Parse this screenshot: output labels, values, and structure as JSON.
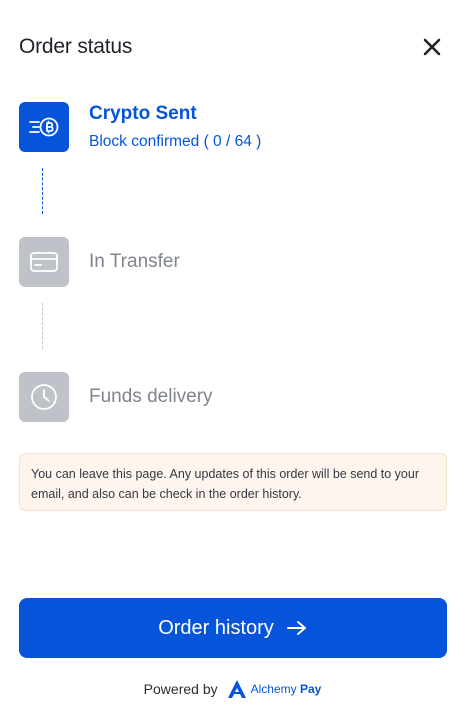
{
  "header": {
    "title": "Order status",
    "close_icon": "close-icon"
  },
  "steps": [
    {
      "title": "Crypto Sent",
      "subtitle": "Block confirmed ( 0 / 64 )",
      "icon": "crypto-send-icon",
      "state": "active"
    },
    {
      "title": "In Transfer",
      "icon": "card-icon",
      "state": "inactive"
    },
    {
      "title": "Funds delivery",
      "icon": "clock-icon",
      "state": "inactive"
    }
  ],
  "notice": {
    "text": "You can leave this page. Any updates of this order will be send to your email, and also can be check in the order history."
  },
  "primary_button": {
    "label": "Order history",
    "icon": "arrow-right-icon"
  },
  "footer": {
    "powered_by": "Powered by",
    "brand_name": "Alchemy",
    "brand_suffix": "Pay"
  },
  "colors": {
    "accent": "#0654d9",
    "inactive": "#bfc3c9",
    "notice_bg": "#fef6ee"
  }
}
